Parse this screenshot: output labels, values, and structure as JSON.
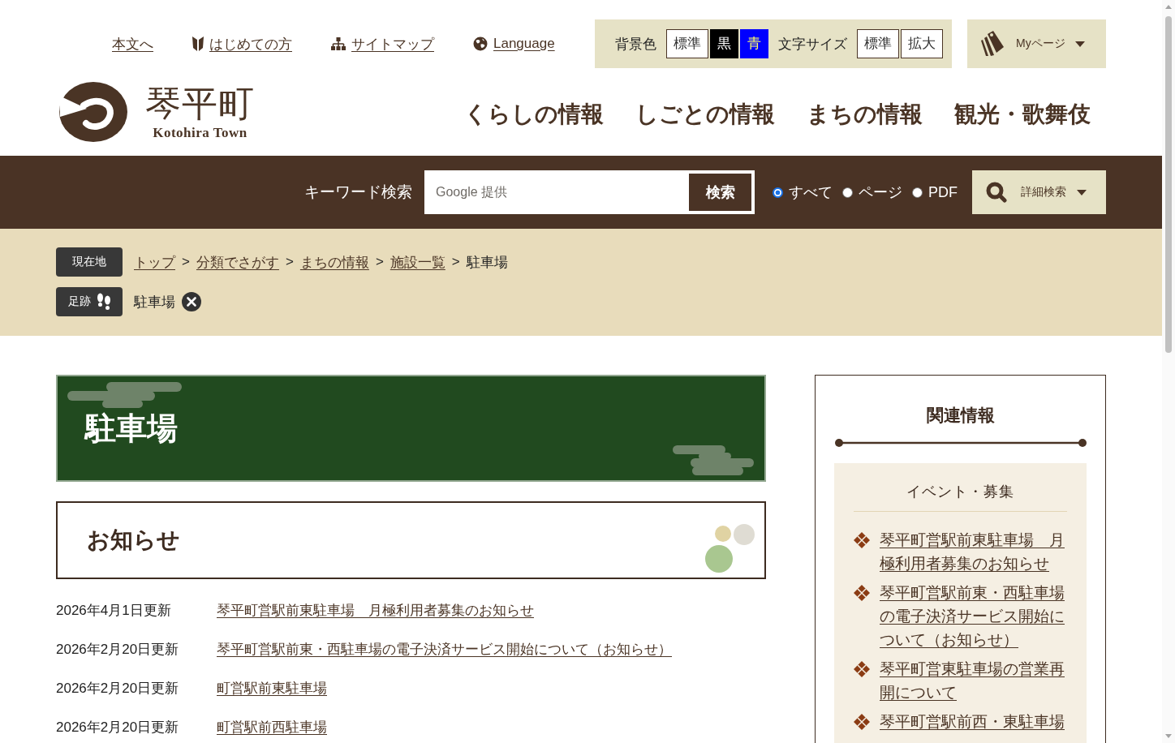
{
  "top_links": [
    {
      "label": "本文へ",
      "kind": "plain"
    },
    {
      "label": "はじめての方",
      "kind": "beginner"
    },
    {
      "label": "サイトマップ",
      "kind": "sitemap"
    },
    {
      "label": "Language",
      "kind": "language"
    }
  ],
  "accessibility": {
    "background_label": "背景色",
    "background_options": [
      {
        "label": "標準",
        "kind": "standard"
      },
      {
        "label": "黒",
        "kind": "black"
      },
      {
        "label": "青",
        "kind": "blue"
      }
    ],
    "font_size_label": "文字サイズ",
    "font_size_options": [
      {
        "label": "標準"
      },
      {
        "label": "拡大"
      }
    ]
  },
  "my_page": {
    "label": "Myページ"
  },
  "logo": {
    "name": "琴平町",
    "subtitle": "Kotohira Town"
  },
  "main_nav": [
    {
      "label": "くらしの情報"
    },
    {
      "label": "しごとの情報"
    },
    {
      "label": "まちの情報"
    },
    {
      "label": "観光・歌舞伎"
    }
  ],
  "search": {
    "label": "キーワード検索",
    "placeholder": "Google 提供",
    "button": "検索",
    "scopes": [
      {
        "label": "すべて",
        "selected": true
      },
      {
        "label": "ページ",
        "selected": false
      },
      {
        "label": "PDF",
        "selected": false
      }
    ],
    "advanced": {
      "label": "詳細検索"
    }
  },
  "breadcrumb": {
    "label": "現在地",
    "items": [
      {
        "label": "トップ",
        "link": true
      },
      {
        "separator": ">",
        "label": "分類でさがす",
        "link": true
      },
      {
        "separator": ">",
        "label": "まちの情報",
        "link": true
      },
      {
        "separator": ">",
        "label": "施設一覧",
        "link": true
      },
      {
        "separator": ">",
        "label": "駐車場",
        "link": false
      }
    ]
  },
  "history": {
    "label": "足跡",
    "items": [
      {
        "label": "駐車場"
      }
    ]
  },
  "page_title": "駐車場",
  "notices": {
    "heading": "お知らせ",
    "items": [
      {
        "date": "2026年4月1日更新",
        "title": "琴平町営駅前東駐車場　月極利用者募集のお知らせ"
      },
      {
        "date": "2026年2月20日更新",
        "title": "琴平町営駅前東・西駐車場の電子決済サービス開始について（お知らせ）"
      },
      {
        "date": "2026年2月20日更新",
        "title": "町営駅前東駐車場"
      },
      {
        "date": "2026年2月20日更新",
        "title": "町営駅前西駐車場"
      }
    ]
  },
  "related": {
    "heading": "関連情報",
    "sections": [
      {
        "heading": "イベント・募集",
        "links": [
          "琴平町営駅前東駐車場　月極利用者募集のお知らせ",
          "琴平町営駅前東・西駐車場の電子決済サービス開始について（お知らせ）",
          "琴平町営東駐車場の営業再開について",
          "琴平町営駅前西・東駐車場"
        ]
      }
    ]
  }
}
